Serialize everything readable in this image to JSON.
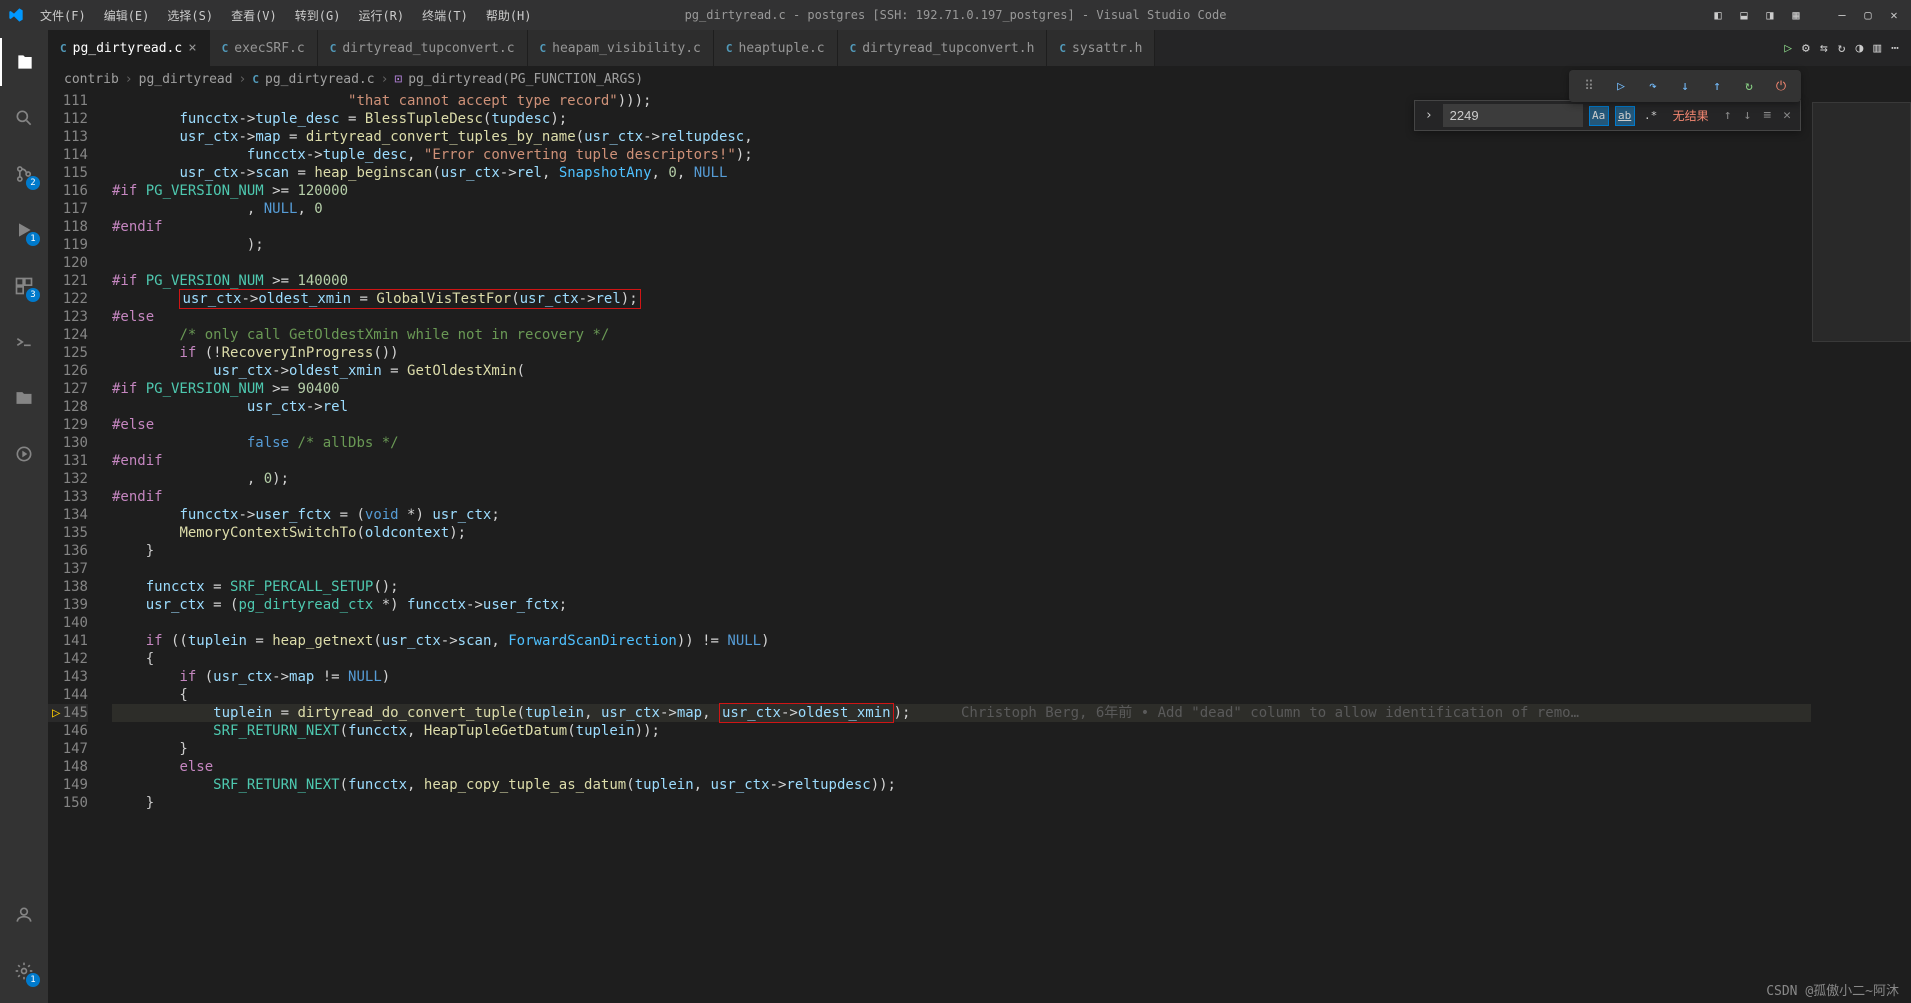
{
  "title": "pg_dirtyread.c - postgres [SSH: 192.71.0.197_postgres] - Visual Studio Code",
  "menu": [
    "文件(F)",
    "编辑(E)",
    "选择(S)",
    "查看(V)",
    "转到(G)",
    "运行(R)",
    "终端(T)",
    "帮助(H)"
  ],
  "activity_badges": {
    "scm": "2",
    "debug": "1",
    "ext": "3",
    "settings": "1"
  },
  "tabs": [
    {
      "icon": "C",
      "label": "pg_dirtyread.c",
      "active": true,
      "dirty": true
    },
    {
      "icon": "C",
      "label": "execSRF.c"
    },
    {
      "icon": "C",
      "label": "dirtyread_tupconvert.c"
    },
    {
      "icon": "C",
      "label": "heapam_visibility.c"
    },
    {
      "icon": "C",
      "label": "heaptuple.c"
    },
    {
      "icon": "C",
      "label": "dirtyread_tupconvert.h"
    },
    {
      "icon": "C",
      "label": "sysattr.h"
    }
  ],
  "breadcrumbs": {
    "parts": [
      "contrib",
      "pg_dirtyread"
    ],
    "file": "pg_dirtyread.c",
    "symbol": "pg_dirtyread(PG_FUNCTION_ARGS)"
  },
  "find": {
    "value": "2249",
    "results": "无结果",
    "match_case": true,
    "whole_word": true,
    "regex": false
  },
  "first_line": 111,
  "last_line": 150,
  "code": {
    "111": [
      [
        "",
        "                            "
      ],
      [
        "s",
        "\"that cannot accept type record\""
      ],
      [
        "op",
        ")));"
      ]
    ],
    "112": [
      [
        "",
        "        "
      ],
      [
        "v",
        "funcctx"
      ],
      [
        "op",
        "->"
      ],
      [
        "v",
        "tuple_desc"
      ],
      [
        "op",
        " = "
      ],
      [
        "f",
        "BlessTupleDesc"
      ],
      [
        "op",
        "("
      ],
      [
        "v",
        "tupdesc"
      ],
      [
        "op",
        ");"
      ]
    ],
    "113": [
      [
        "",
        "        "
      ],
      [
        "v",
        "usr_ctx"
      ],
      [
        "op",
        "->"
      ],
      [
        "v",
        "map"
      ],
      [
        "op",
        " = "
      ],
      [
        "f",
        "dirtyread_convert_tuples_by_name"
      ],
      [
        "op",
        "("
      ],
      [
        "v",
        "usr_ctx"
      ],
      [
        "op",
        "->"
      ],
      [
        "v",
        "reltupdesc"
      ],
      [
        "op",
        ","
      ]
    ],
    "114": [
      [
        "",
        "                "
      ],
      [
        "v",
        "funcctx"
      ],
      [
        "op",
        "->"
      ],
      [
        "v",
        "tuple_desc"
      ],
      [
        "op",
        ", "
      ],
      [
        "s",
        "\"Error converting tuple descriptors!\""
      ],
      [
        "op",
        ");"
      ]
    ],
    "115": [
      [
        "",
        "        "
      ],
      [
        "v",
        "usr_ctx"
      ],
      [
        "op",
        "->"
      ],
      [
        "v",
        "scan"
      ],
      [
        "op",
        " = "
      ],
      [
        "f",
        "heap_beginscan"
      ],
      [
        "op",
        "("
      ],
      [
        "v",
        "usr_ctx"
      ],
      [
        "op",
        "->"
      ],
      [
        "v",
        "rel"
      ],
      [
        "op",
        ", "
      ],
      [
        "const",
        "SnapshotAny"
      ],
      [
        "op",
        ", "
      ],
      [
        "n",
        "0"
      ],
      [
        "op",
        ", "
      ],
      [
        "d",
        "NULL"
      ]
    ],
    "116": [
      [
        "k",
        "#if "
      ],
      [
        "t",
        "PG_VERSION_NUM"
      ],
      [
        "op",
        " >= "
      ],
      [
        "n",
        "120000"
      ]
    ],
    "117": [
      [
        "",
        "                , "
      ],
      [
        "d",
        "NULL"
      ],
      [
        "op",
        ", "
      ],
      [
        "n",
        "0"
      ]
    ],
    "118": [
      [
        "k",
        "#endif"
      ]
    ],
    "119": [
      [
        "",
        "                );"
      ]
    ],
    "120": [
      [
        "",
        ""
      ]
    ],
    "121": [
      [
        "k",
        "#if "
      ],
      [
        "t",
        "PG_VERSION_NUM"
      ],
      [
        "op",
        " >= "
      ],
      [
        "n",
        "140000"
      ]
    ],
    "122": [
      [
        "",
        "        "
      ],
      [
        "rb_open",
        ""
      ],
      [
        "v",
        "usr_ctx"
      ],
      [
        "op",
        "->"
      ],
      [
        "v",
        "oldest_xmin"
      ],
      [
        "op",
        " = "
      ],
      [
        "f",
        "GlobalVisTestFor"
      ],
      [
        "op",
        "("
      ],
      [
        "v",
        "usr_ctx"
      ],
      [
        "op",
        "->"
      ],
      [
        "v",
        "rel"
      ],
      [
        "op",
        ");"
      ],
      [
        "rb_close",
        ""
      ]
    ],
    "123": [
      [
        "k",
        "#else"
      ]
    ],
    "124": [
      [
        "",
        "        "
      ],
      [
        "c",
        "/* only call GetOldestXmin while not in recovery */"
      ]
    ],
    "125": [
      [
        "",
        "        "
      ],
      [
        "k",
        "if"
      ],
      [
        "op",
        " (!"
      ],
      [
        "f",
        "RecoveryInProgress"
      ],
      [
        "op",
        "())"
      ]
    ],
    "126": [
      [
        "",
        "            "
      ],
      [
        "v",
        "usr_ctx"
      ],
      [
        "op",
        "->"
      ],
      [
        "v",
        "oldest_xmin"
      ],
      [
        "op",
        " = "
      ],
      [
        "f",
        "GetOldestXmin"
      ],
      [
        "op",
        "("
      ]
    ],
    "127": [
      [
        "k",
        "#if "
      ],
      [
        "t",
        "PG_VERSION_NUM"
      ],
      [
        "op",
        " >= "
      ],
      [
        "n",
        "90400"
      ]
    ],
    "128": [
      [
        "",
        "                "
      ],
      [
        "v",
        "usr_ctx"
      ],
      [
        "op",
        "->"
      ],
      [
        "v",
        "rel"
      ]
    ],
    "129": [
      [
        "k",
        "#else"
      ]
    ],
    "130": [
      [
        "",
        "                "
      ],
      [
        "d",
        "false"
      ],
      [
        "op",
        " "
      ],
      [
        "c",
        "/* allDbs */"
      ]
    ],
    "131": [
      [
        "k",
        "#endif"
      ]
    ],
    "132": [
      [
        "",
        "                , "
      ],
      [
        "n",
        "0"
      ],
      [
        "op",
        ");"
      ]
    ],
    "133": [
      [
        "k",
        "#endif"
      ]
    ],
    "134": [
      [
        "",
        "        "
      ],
      [
        "v",
        "funcctx"
      ],
      [
        "op",
        "->"
      ],
      [
        "v",
        "user_fctx"
      ],
      [
        "op",
        " = ("
      ],
      [
        "d",
        "void"
      ],
      [
        "op",
        " *) "
      ],
      [
        "v",
        "usr_ctx"
      ],
      [
        "op",
        ";"
      ]
    ],
    "135": [
      [
        "",
        "        "
      ],
      [
        "f",
        "MemoryContextSwitchTo"
      ],
      [
        "op",
        "("
      ],
      [
        "v",
        "oldcontext"
      ],
      [
        "op",
        ");"
      ]
    ],
    "136": [
      [
        "",
        "    }"
      ]
    ],
    "137": [
      [
        "",
        ""
      ]
    ],
    "138": [
      [
        "",
        "    "
      ],
      [
        "v",
        "funcctx"
      ],
      [
        "op",
        " = "
      ],
      [
        "t",
        "SRF_PERCALL_SETUP"
      ],
      [
        "op",
        "();"
      ]
    ],
    "139": [
      [
        "",
        "    "
      ],
      [
        "v",
        "usr_ctx"
      ],
      [
        "op",
        " = ("
      ],
      [
        "t",
        "pg_dirtyread_ctx"
      ],
      [
        "op",
        " *) "
      ],
      [
        "v",
        "funcctx"
      ],
      [
        "op",
        "->"
      ],
      [
        "v",
        "user_fctx"
      ],
      [
        "op",
        ";"
      ]
    ],
    "140": [
      [
        "",
        ""
      ]
    ],
    "141": [
      [
        "",
        "    "
      ],
      [
        "k",
        "if"
      ],
      [
        "op",
        " (("
      ],
      [
        "v",
        "tuplein"
      ],
      [
        "op",
        " = "
      ],
      [
        "f",
        "heap_getnext"
      ],
      [
        "op",
        "("
      ],
      [
        "v",
        "usr_ctx"
      ],
      [
        "op",
        "->"
      ],
      [
        "v",
        "scan"
      ],
      [
        "op",
        ", "
      ],
      [
        "const",
        "ForwardScanDirection"
      ],
      [
        "op",
        ")) != "
      ],
      [
        "d",
        "NULL"
      ],
      [
        "op",
        ")"
      ]
    ],
    "142": [
      [
        "",
        "    {"
      ]
    ],
    "143": [
      [
        "",
        "        "
      ],
      [
        "k",
        "if"
      ],
      [
        "op",
        " ("
      ],
      [
        "v",
        "usr_ctx"
      ],
      [
        "op",
        "->"
      ],
      [
        "v",
        "map"
      ],
      [
        "op",
        " != "
      ],
      [
        "d",
        "NULL"
      ],
      [
        "op",
        ")"
      ]
    ],
    "144": [
      [
        "",
        "        {"
      ]
    ],
    "145": [
      [
        "",
        "            "
      ],
      [
        "v",
        "tuplein"
      ],
      [
        "op",
        " = "
      ],
      [
        "f",
        "dirtyread_do_convert_tuple"
      ],
      [
        "op",
        "("
      ],
      [
        "v",
        "tuplein"
      ],
      [
        "op",
        ", "
      ],
      [
        "v",
        "usr_ctx"
      ],
      [
        "op",
        "->"
      ],
      [
        "v",
        "map"
      ],
      [
        "op",
        ", "
      ],
      [
        "rb_open",
        ""
      ],
      [
        "v",
        "usr_ctx"
      ],
      [
        "op",
        "->"
      ],
      [
        "v",
        "oldest_xmin"
      ],
      [
        "rb_close",
        ""
      ],
      [
        "op",
        ");"
      ],
      [
        "",
        "      "
      ],
      [
        "blame",
        "Christoph Berg, 6年前 • Add \"dead\" column to allow identification of remo…"
      ]
    ],
    "146": [
      [
        "",
        "            "
      ],
      [
        "t",
        "SRF_RETURN_NEXT"
      ],
      [
        "op",
        "("
      ],
      [
        "v",
        "funcctx"
      ],
      [
        "op",
        ", "
      ],
      [
        "f",
        "HeapTupleGetDatum"
      ],
      [
        "op",
        "("
      ],
      [
        "v",
        "tuplein"
      ],
      [
        "op",
        "));"
      ]
    ],
    "147": [
      [
        "",
        "        }"
      ]
    ],
    "148": [
      [
        "",
        "        "
      ],
      [
        "k",
        "else"
      ]
    ],
    "149": [
      [
        "",
        "            "
      ],
      [
        "t",
        "SRF_RETURN_NEXT"
      ],
      [
        "op",
        "("
      ],
      [
        "v",
        "funcctx"
      ],
      [
        "op",
        ", "
      ],
      [
        "f",
        "heap_copy_tuple_as_datum"
      ],
      [
        "op",
        "("
      ],
      [
        "v",
        "tuplein"
      ],
      [
        "op",
        ", "
      ],
      [
        "v",
        "usr_ctx"
      ],
      [
        "op",
        "->"
      ],
      [
        "v",
        "reltupdesc"
      ],
      [
        "op",
        "));"
      ]
    ],
    "150": [
      [
        "",
        "    }"
      ]
    ]
  },
  "current_line": 145,
  "watermark": "CSDN @孤傲小二~阿沐"
}
